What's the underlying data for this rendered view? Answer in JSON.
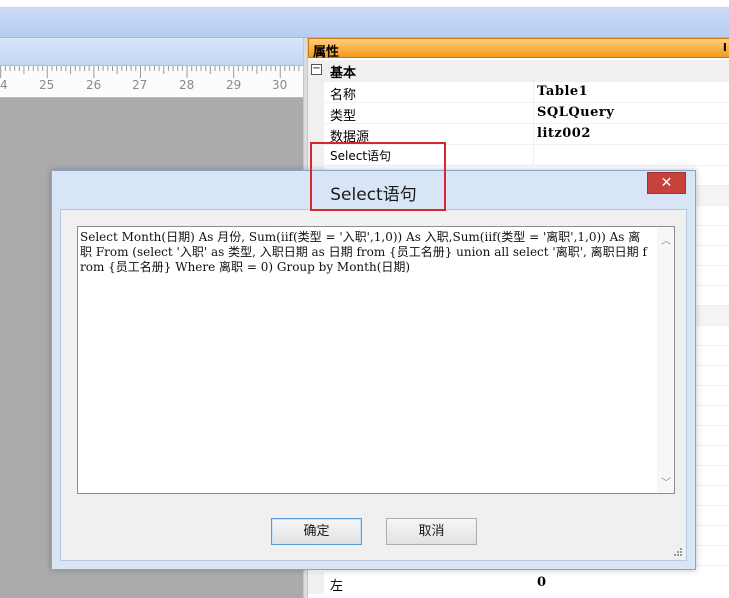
{
  "ruler": {
    "ticks": [
      "4",
      "25",
      "26",
      "27",
      "28",
      "29",
      "30"
    ]
  },
  "properties": {
    "header": "属性",
    "header_pin": "I",
    "category": "基本",
    "category_toggle": "−",
    "rows": [
      {
        "key": "名称",
        "value": "Table1"
      },
      {
        "key": "类型",
        "value": "SQLQuery"
      },
      {
        "key": "数据源",
        "value": "litz002"
      },
      {
        "key": "Select语句",
        "value": ""
      }
    ],
    "bottom_row": {
      "key": "左",
      "value": "0"
    }
  },
  "dialog": {
    "title": "Select语句",
    "close_label": "✕",
    "sql": "Select Month(日期) As 月份, Sum(iif(类型 = '入职',1,0)) As 入职,Sum(iif(类型 = '离职',1,0)) As 离职 From (select '入职' as 类型, 入职日期 as 日期 from {员工名册} union all select '离职', 离职日期 from {员工名册} Where 离职 = 0) Group by Month(日期)",
    "ok_label": "确定",
    "cancel_label": "取消"
  },
  "colors": {
    "accent_header": "#f39a1c",
    "highlight": "#d4282f",
    "close": "#c7423b"
  }
}
